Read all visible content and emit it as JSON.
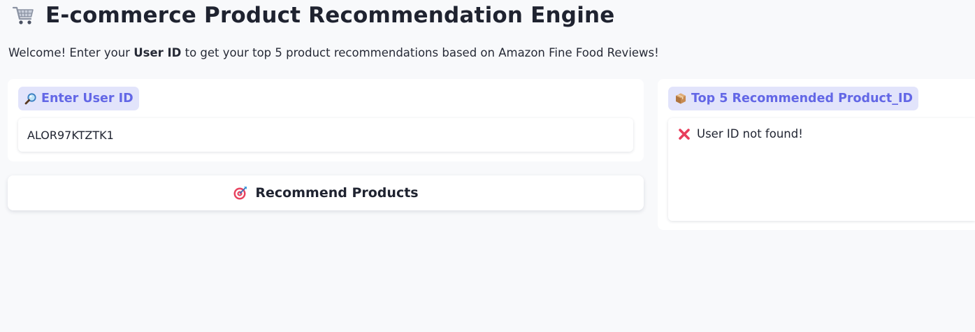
{
  "header": {
    "icon": "shopping-cart-icon",
    "title": "E-commerce Product Recommendation Engine"
  },
  "intro": {
    "before": "Welcome! Enter your ",
    "emphasis": "User ID",
    "after": " to get your top 5 product recommendations based on Amazon Fine Food Reviews!"
  },
  "input_panel": {
    "label_icon": "magnifier-icon",
    "label": "Enter User ID",
    "value": "ALOR97KTZTK1"
  },
  "recommend_button": {
    "icon": "target-icon",
    "label": "Recommend Products"
  },
  "output_panel": {
    "label_icon": "package-icon",
    "label": "Top 5 Recommended Product_ID",
    "result_icon": "cross-mark-icon",
    "result_text": "User ID not found!"
  },
  "colors": {
    "background": "#f8f9fb",
    "panel": "#ffffff",
    "label_pill_bg": "#e2e4fb",
    "label_pill_text": "#6367e6",
    "text": "#1f2330",
    "error_cross": "#e83e5c"
  }
}
